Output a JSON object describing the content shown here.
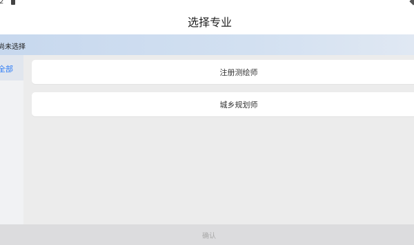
{
  "status_bar": {
    "time": "2"
  },
  "header": {
    "title": "选择专业"
  },
  "selected": {
    "text": "尚未选择"
  },
  "sidebar": {
    "items": [
      {
        "label": "全部"
      }
    ]
  },
  "majors": [
    {
      "label": "注册测绘师"
    },
    {
      "label": "城乡规划师"
    }
  ],
  "footer": {
    "confirm_label": "确认"
  },
  "colors": {
    "accent": "#2d7cf6",
    "selected_bar": "#c7d8ee",
    "confirm_bar": "#dcdcde"
  }
}
